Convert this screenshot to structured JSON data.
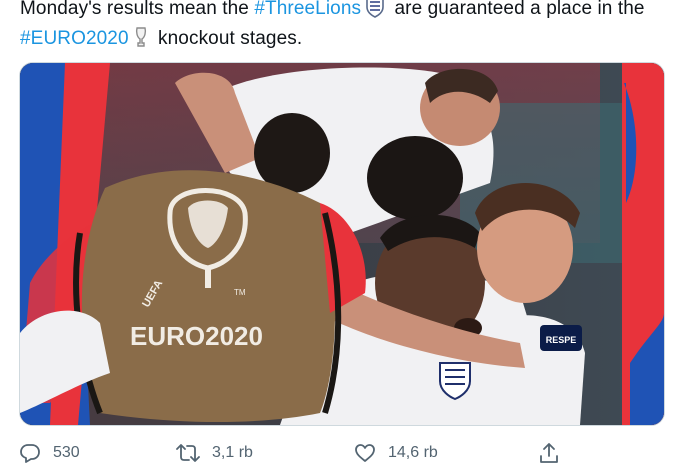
{
  "tweet": {
    "line1_before": "Monday's results mean the",
    "hashtag1": "#ThreeLions",
    "line1_after": "are guaranteed a place in the",
    "hashtag2": "#EURO2020",
    "line2_after": "knockout stages.",
    "emoji1": "england-crest-icon",
    "emoji2": "trophy-icon"
  },
  "media": {
    "alt": "England players celebrating a goal",
    "bib_logo_small": "UEFA",
    "bib_logo_large": "EURO2020",
    "bib_tm": "TM",
    "armband_text": "RESPE",
    "colors": {
      "border_blue": "#1f53b5",
      "border_red": "#e8333b",
      "white_kit": "#f1f1f3",
      "bib": "#8a6c49"
    }
  },
  "actions": {
    "reply_count": "530",
    "retweet_count": "3,1 rb",
    "like_count": "14,6 rb",
    "reply_icon": "reply-icon",
    "retweet_icon": "retweet-icon",
    "like_icon": "heart-icon",
    "share_icon": "share-icon"
  }
}
